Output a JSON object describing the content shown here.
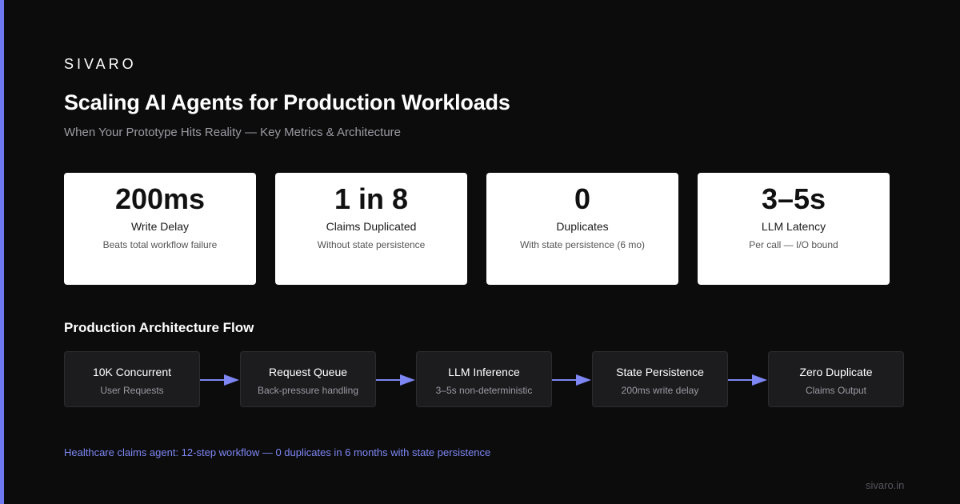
{
  "brand": "SIVARO",
  "title": "Scaling AI Agents for Production Workloads",
  "subtitle": "When Your Prototype Hits Reality — Key Metrics & Architecture",
  "metrics": [
    {
      "value": "200ms",
      "label": "Write Delay",
      "note": "Beats total workflow failure"
    },
    {
      "value": "1 in 8",
      "label": "Claims Duplicated",
      "note": "Without state persistence"
    },
    {
      "value": "0",
      "label": "Duplicates",
      "note": "With state persistence (6 mo)"
    },
    {
      "value": "3–5s",
      "label": "LLM Latency",
      "note": "Per call — I/O bound"
    }
  ],
  "flow": {
    "title": "Production Architecture Flow",
    "steps": [
      {
        "name": "10K Concurrent",
        "desc": "User Requests"
      },
      {
        "name": "Request Queue",
        "desc": "Back-pressure handling"
      },
      {
        "name": "LLM Inference",
        "desc": "3–5s non-deterministic"
      },
      {
        "name": "State Persistence",
        "desc": "200ms write delay"
      },
      {
        "name": "Zero Duplicate",
        "desc": "Claims Output"
      }
    ]
  },
  "footnote": "Healthcare claims agent: 12-step workflow — 0 duplicates in 6 months with state persistence",
  "site": "sivaro.in",
  "colors": {
    "accent": "#6e79f0",
    "background": "#0c0c0d",
    "card": "#ffffff",
    "flow_box": "#1c1c1f"
  }
}
